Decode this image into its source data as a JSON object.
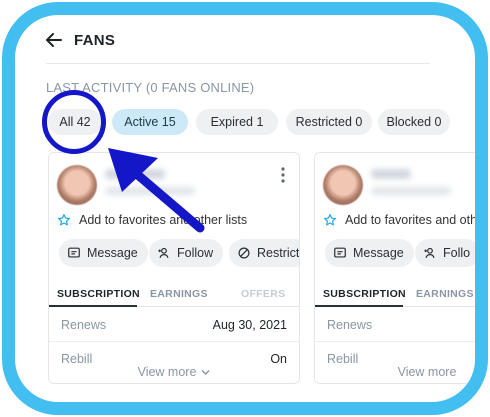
{
  "header": {
    "title": "FANS",
    "back_icon": "arrow-left-icon"
  },
  "section_label": "LAST ACTIVITY (0 FANS ONLINE)",
  "filters": [
    {
      "label": "All 42",
      "selected": false
    },
    {
      "label": "Active 15",
      "selected": true
    },
    {
      "label": "Expired 1",
      "selected": false
    },
    {
      "label": "Restricted 0",
      "selected": false
    },
    {
      "label": "Blocked 0",
      "selected": false
    }
  ],
  "cards": [
    {
      "favorites_text": "Add to favorites and other lists",
      "buttons": {
        "message": "Message",
        "follow": "Follow",
        "restrict": "Restrict"
      },
      "tabs": [
        "SUBSCRIPTION",
        "EARNINGS",
        "OFFERS"
      ],
      "rows": [
        {
          "key": "Renews",
          "value": "Aug 30, 2021"
        },
        {
          "key": "Rebill",
          "value": "On"
        }
      ],
      "view_more": "View more"
    },
    {
      "favorites_text": "Add to favorites and oth",
      "buttons": {
        "message": "Message",
        "follow": "Follo"
      },
      "tabs": [
        "SUBSCRIPTION",
        "EARNINGS"
      ],
      "rows": [
        {
          "key": "Renews",
          "value": ""
        },
        {
          "key": "Rebill",
          "value": ""
        }
      ],
      "view_more": "View more"
    }
  ],
  "colors": {
    "frame": "#42bff0",
    "annotation": "#1417c8",
    "active_chip": "#cde9f8",
    "chip": "#eef0f2"
  }
}
